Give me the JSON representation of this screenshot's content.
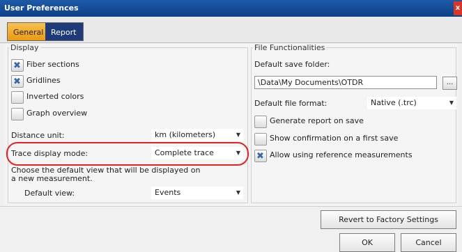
{
  "window": {
    "title": "User Preferences",
    "close_glyph": "x"
  },
  "tabs": [
    {
      "label": "General",
      "active": true
    },
    {
      "label": "Report",
      "active": false
    }
  ],
  "display": {
    "legend": "Display",
    "fiber_sections": {
      "label": "Fiber sections",
      "checked": true
    },
    "gridlines": {
      "label": "Gridlines",
      "checked": true
    },
    "inverted_colors": {
      "label": "Inverted colors",
      "checked": false
    },
    "graph_overview": {
      "label": "Graph overview",
      "checked": false
    },
    "distance_unit": {
      "label": "Distance unit:",
      "value": "km (kilometers)"
    },
    "trace_display_mode": {
      "label": "Trace display mode:",
      "value": "Complete trace"
    },
    "default_view_hint": "Choose the default view that will be displayed on a new measurement.",
    "default_view": {
      "label": "Default view:",
      "value": "Events"
    }
  },
  "file_functionalities": {
    "legend": "File Functionalities",
    "save_folder_label": "Default save folder:",
    "save_folder_value": "\\Data\\My Documents\\OTDR",
    "browse_label": "...",
    "file_format_label": "Default file format:",
    "file_format_value": "Native (.trc)",
    "generate_report": {
      "label": "Generate report on save",
      "checked": false
    },
    "show_confirmation": {
      "label": "Show confirmation on a first save",
      "checked": false
    },
    "allow_reference": {
      "label": "Allow using reference measurements",
      "checked": true
    }
  },
  "buttons": {
    "revert": "Revert to Factory Settings",
    "ok": "OK",
    "cancel": "Cancel"
  },
  "colors": {
    "titlebar": "#1e5aa8",
    "tab_active": "#eb9a12",
    "tab_inactive": "#1e3a7a",
    "highlight": "#e32221",
    "checkmark": "#3568a6"
  }
}
